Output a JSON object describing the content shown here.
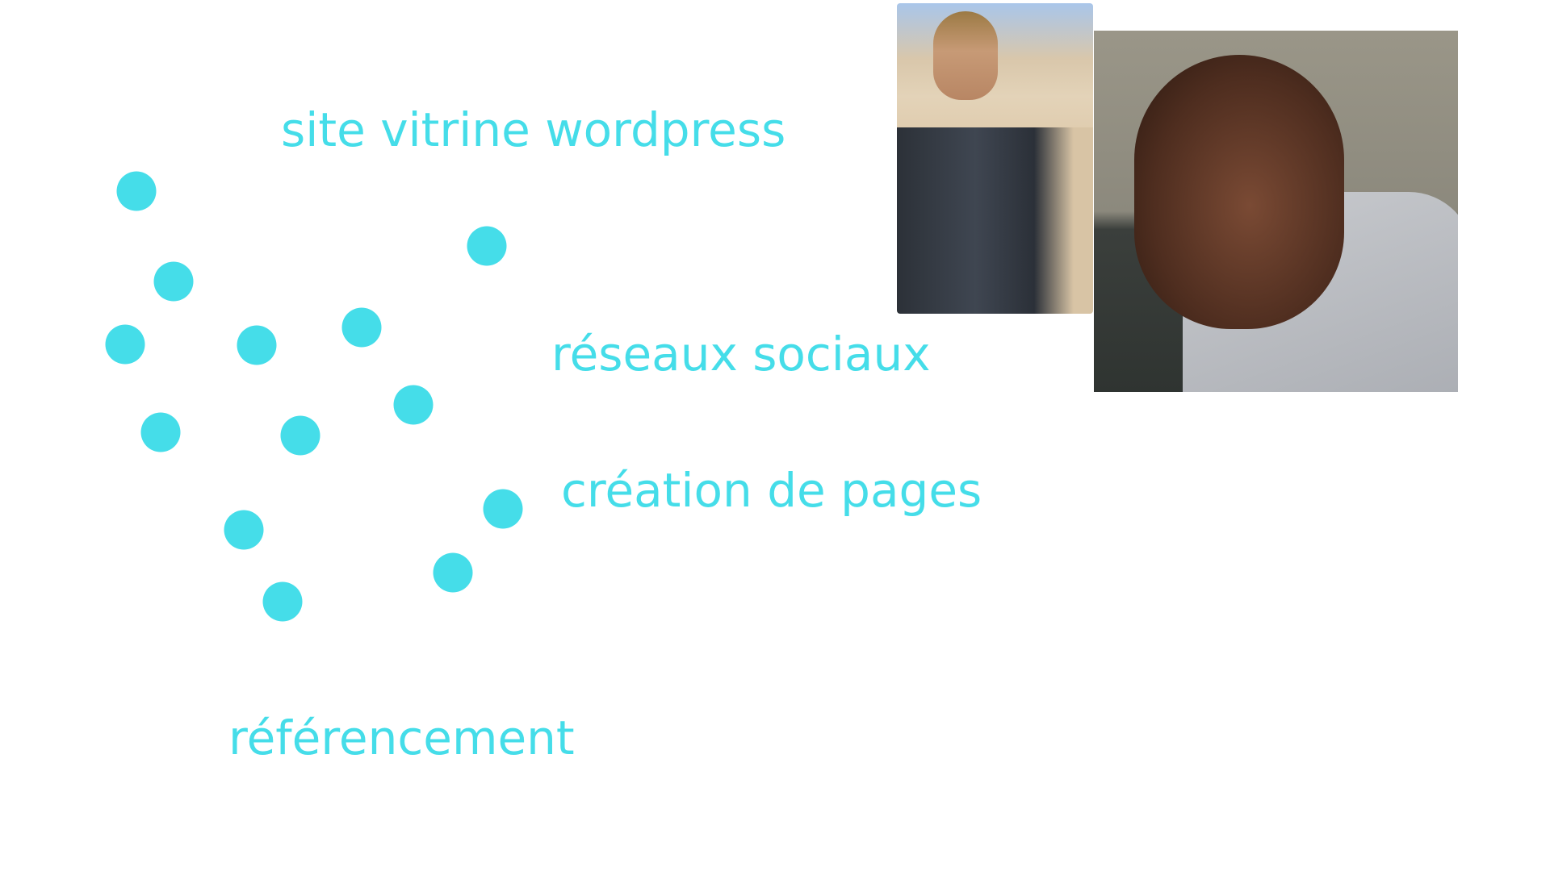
{
  "labels": {
    "site_vitrine": "site vitrine wordpress",
    "reseaux": "réseaux sociaux",
    "creation": "création de pages",
    "referencement": "référencement"
  },
  "accent_color": "#45dde9",
  "dot_count": 13
}
